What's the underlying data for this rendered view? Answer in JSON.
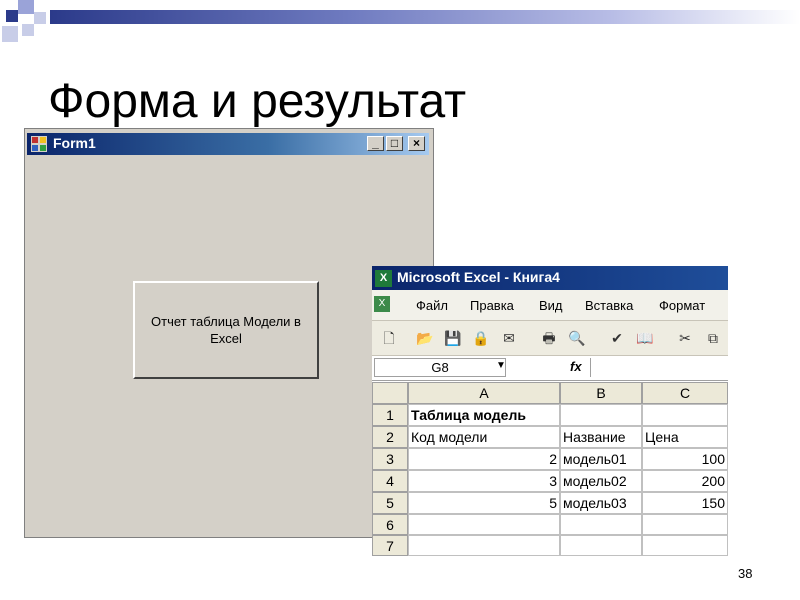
{
  "slide": {
    "title": "Форма и результат",
    "page_number": "38"
  },
  "form": {
    "title": "Form1",
    "caption_buttons": [
      "_",
      "□",
      "×"
    ],
    "button_label": "Отчет таблица Модели в Excel"
  },
  "excel": {
    "title": "Microsoft Excel - Книга4",
    "menu": [
      "Файл",
      "Правка",
      "Вид",
      "Вставка",
      "Формат"
    ],
    "name_box": "G8",
    "fx_label": "fx",
    "columns": [
      "A",
      "B",
      "C"
    ],
    "rows": [
      "1",
      "2",
      "3",
      "4",
      "5",
      "6",
      "7"
    ],
    "cells": [
      [
        "Таблица модель",
        "",
        ""
      ],
      [
        "Код модели",
        "Название",
        "Цена"
      ],
      [
        "2",
        "модель01",
        "100"
      ],
      [
        "3",
        "модель02",
        "200"
      ],
      [
        "5",
        "модель03",
        "150"
      ],
      [
        "",
        "",
        ""
      ],
      [
        "",
        "",
        ""
      ]
    ],
    "toolbar_icons": [
      "new-icon",
      "open-icon",
      "save-icon",
      "permission-icon",
      "email-icon",
      "print-icon",
      "print-preview-icon",
      "spelling-icon",
      "research-icon",
      "cut-icon",
      "copy-icon"
    ]
  }
}
